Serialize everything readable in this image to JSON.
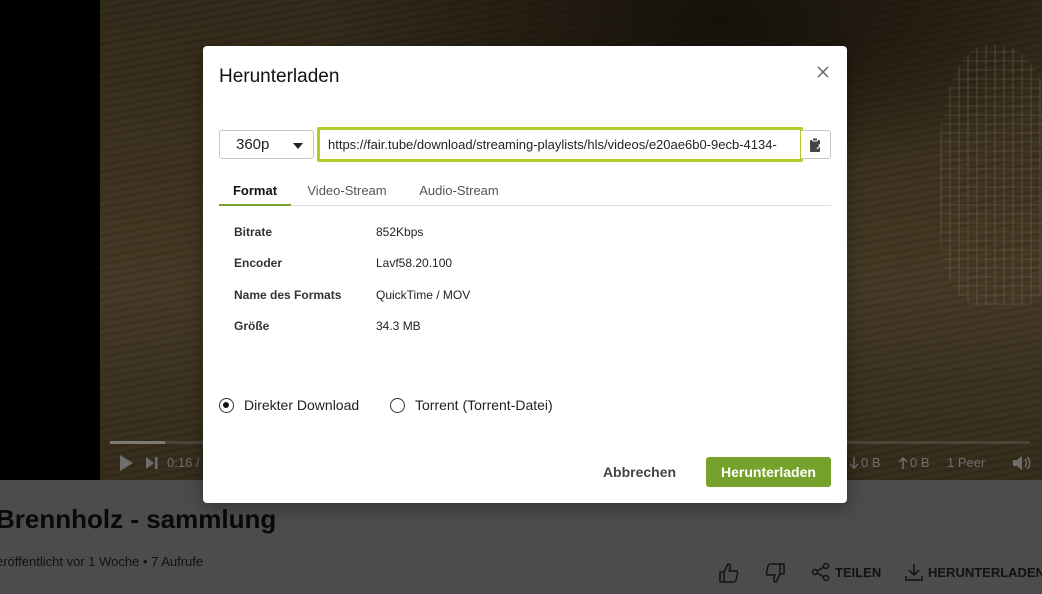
{
  "player": {
    "time": "0:16 / 5",
    "download_speed": "0 B",
    "upload_speed": "0 B",
    "peers": "1 Peer",
    "progress": 0.06
  },
  "video": {
    "title": "Brennholz - sammlung",
    "meta": "eröffentlicht vor 1 Woche • 7 Aufrufe",
    "actions": {
      "share_label": "TEILEN",
      "download_label": "HERUNTERLADEN"
    }
  },
  "modal": {
    "title": "Herunterladen",
    "resolution": "360p",
    "url": "https://fair.tube/download/streaming-playlists/hls/videos/e20ae6b0-9ecb-4134-",
    "tabs": [
      {
        "label": "Format",
        "active": true
      },
      {
        "label": "Video-Stream",
        "active": false
      },
      {
        "label": "Audio-Stream",
        "active": false
      }
    ],
    "info": [
      {
        "label": "Bitrate",
        "value": "852Kbps"
      },
      {
        "label": "Encoder",
        "value": "Lavf58.20.100"
      },
      {
        "label": "Name des Formats",
        "value": "QuickTime / MOV"
      },
      {
        "label": "Größe",
        "value": "34.3 MB"
      }
    ],
    "options": [
      {
        "label": "Direkter Download",
        "checked": true
      },
      {
        "label": "Torrent (Torrent-Datei)",
        "checked": false
      }
    ],
    "cancel_label": "Abbrechen",
    "download_label": "Herunterladen"
  },
  "colors": {
    "accent": "#76a12a",
    "focus_border": "#b5c92f"
  }
}
